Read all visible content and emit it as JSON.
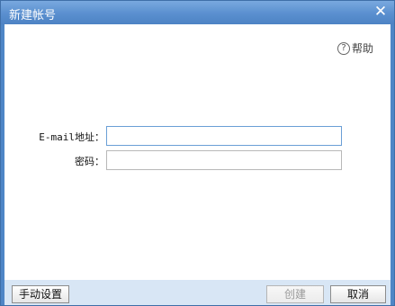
{
  "window": {
    "title": "新建帐号",
    "close_symbol": "✕"
  },
  "help": {
    "icon_glyph": "?",
    "label": "帮助"
  },
  "form": {
    "email": {
      "label": "E-mail地址：",
      "value": ""
    },
    "password": {
      "label": "密码：",
      "value": ""
    }
  },
  "footer": {
    "manual_settings_label": "手动设置",
    "create_label": "创建",
    "cancel_label": "取消"
  }
}
